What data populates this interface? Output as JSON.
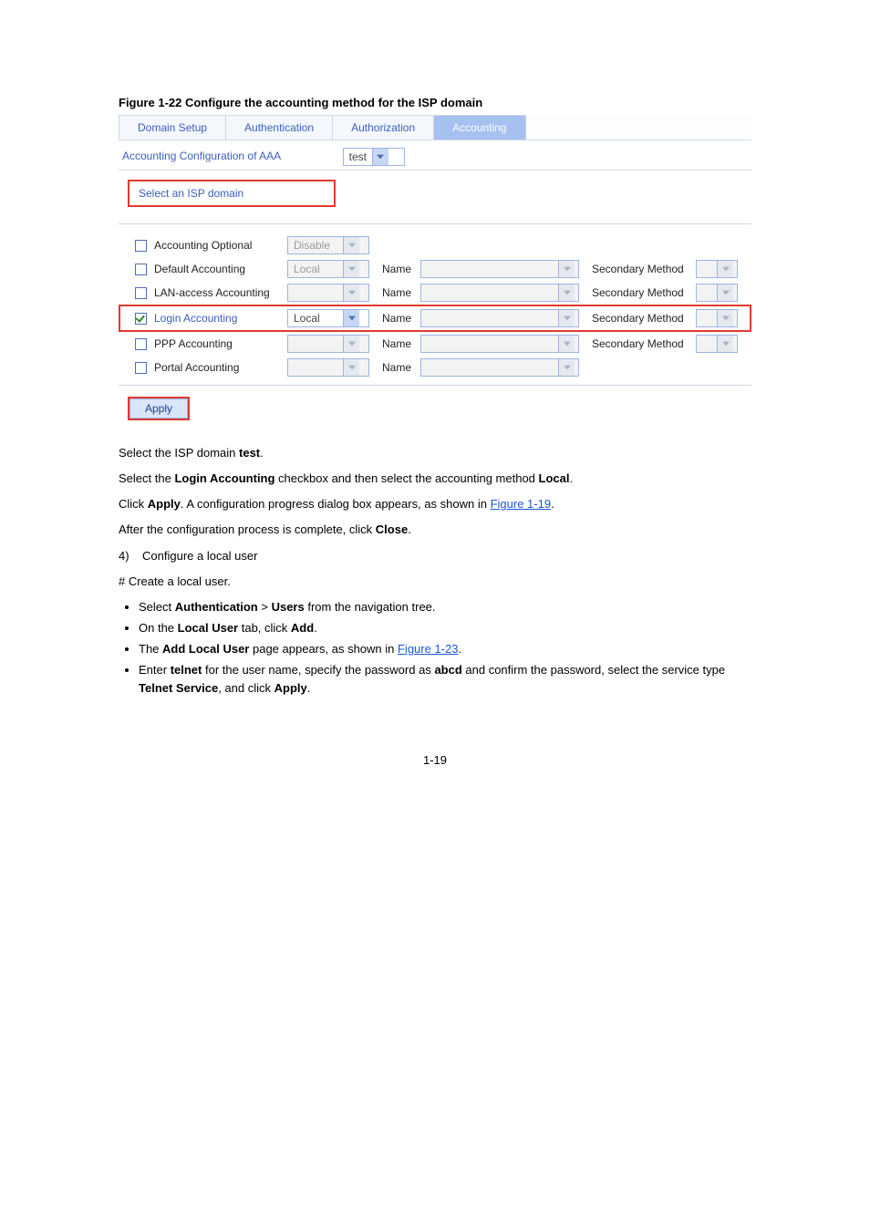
{
  "figure": {
    "label": "Figure 1-22 Configure the accounting method for the ISP domain"
  },
  "tabs": {
    "domain": "Domain Setup",
    "authn": "Authentication",
    "authz": "Authorization",
    "acct": "Accounting"
  },
  "panel": {
    "title": "Accounting Configuration of AAA",
    "select_label": "Select an ISP domain",
    "domain_value": "test",
    "rows": {
      "optional": {
        "label": "Accounting Optional",
        "primary": "Disable"
      },
      "default": {
        "label": "Default Accounting",
        "primary": "Local",
        "name": "Name",
        "secondary_label": "Secondary Method"
      },
      "lan": {
        "label": "LAN-access Accounting",
        "primary": "",
        "name": "Name",
        "secondary_label": "Secondary Method"
      },
      "login": {
        "label": "Login Accounting",
        "primary": "Local",
        "name": "Name",
        "secondary_label": "Secondary Method"
      },
      "ppp": {
        "label": "PPP Accounting",
        "primary": "",
        "name": "Name",
        "secondary_label": "Secondary Method"
      },
      "portal": {
        "label": "Portal Accounting",
        "primary": "",
        "name": "Name"
      }
    },
    "apply": "Apply"
  },
  "body": {
    "para1_a": "Select the ISP domain ",
    "para1_b": "test",
    "para1_c": ".",
    "para2_a": "Select the ",
    "para2_b": "Login Accounting",
    "para2_c": " checkbox and then select the accounting method ",
    "para2_d": "Local",
    "para2_e": ".",
    "para3_a": "Click ",
    "para3_b": "Apply",
    "para3_c": ". A configuration progress dialog box appears, as shown in ",
    "para3_link": "Figure 1-19",
    "para3_d": ".",
    "para4_a": "After the configuration process is complete, click ",
    "para4_b": "Close",
    "para4_c": ".",
    "numstep": "4)",
    "numstep_label": "Configure a local user",
    "localuser_intro": "# Create a local user.",
    "bullets": {
      "b1_a": "Select ",
      "b1_b": "Authentication",
      "b1_c": " > ",
      "b1_d": "Users",
      "b1_e": " from the navigation tree.",
      "b2_a": "On the ",
      "b2_b": "Local User",
      "b2_c": " tab, click ",
      "b2_d": "Add",
      "b2_e": ".",
      "b3_a": "The ",
      "b3_b": "Add Local User",
      "b3_c": " page appears, as shown in ",
      "b3_link": "Figure 1-23",
      "b3_d": ".",
      "b4_a": "Enter ",
      "b4_b": "telnet",
      "b4_c": " for the user name, specify the password as ",
      "b4_d": "abcd",
      "b4_e": " and confirm the password, select the service type ",
      "b4_f": "Telnet Service",
      "b4_g": ", and click ",
      "b4_h": "Apply",
      "b4_i": "."
    }
  },
  "page_number": "1-19"
}
